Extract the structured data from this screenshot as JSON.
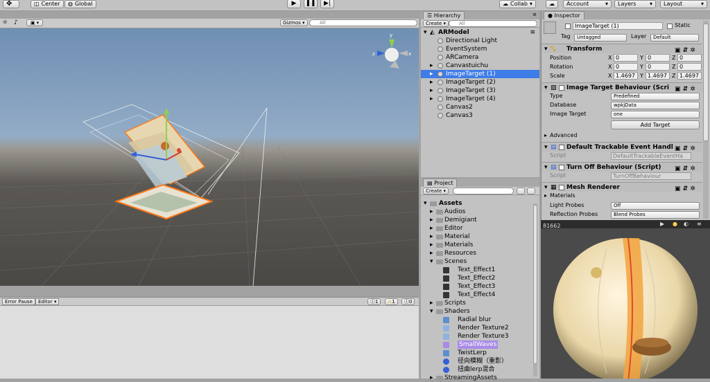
{
  "toolbar": {
    "pivot": "Center",
    "space": "Global",
    "collab": "Collab",
    "account": "Account",
    "layers": "Layers",
    "layout": "Layout"
  },
  "scene": {
    "gizmos": "Gizmos",
    "search_placeholder": "All"
  },
  "console": {
    "error_pause": "Error Pause",
    "editor": "Editor",
    "log_count": "1",
    "warn_count": "1",
    "error_count": "0"
  },
  "hierarchy": {
    "tab": "Hierarchy",
    "create": "Create",
    "search_placeholder": "All",
    "root": "ARModel",
    "items": [
      {
        "label": "Directional Light",
        "expandable": false
      },
      {
        "label": "EventSystem",
        "expandable": false
      },
      {
        "label": "ARCamera",
        "expandable": false
      },
      {
        "label": "Canvastuichu",
        "expandable": true
      },
      {
        "label": "ImageTarget (1)",
        "expandable": true,
        "selected": true
      },
      {
        "label": "ImageTarget (2)",
        "expandable": true
      },
      {
        "label": "ImageTarget (3)",
        "expandable": true
      },
      {
        "label": "ImageTarget (4)",
        "expandable": true
      },
      {
        "label": "Canvas2",
        "expandable": false
      },
      {
        "label": "Canvas3",
        "expandable": false
      }
    ]
  },
  "project": {
    "tab": "Project",
    "create": "Create",
    "root": "Assets",
    "items": [
      {
        "label": "Audios",
        "type": "folder",
        "indent": 1
      },
      {
        "label": "Demigiant",
        "type": "folder",
        "indent": 1
      },
      {
        "label": "Editor",
        "type": "folder",
        "indent": 1
      },
      {
        "label": "Material",
        "type": "folder",
        "indent": 1
      },
      {
        "label": "Materials",
        "type": "folder",
        "indent": 1
      },
      {
        "label": "Resources",
        "type": "folder",
        "indent": 1
      },
      {
        "label": "Scenes",
        "type": "folder-open",
        "indent": 1
      },
      {
        "label": "Text_Effect1",
        "type": "scene",
        "indent": 2
      },
      {
        "label": "Text_Effect2",
        "type": "scene",
        "indent": 2
      },
      {
        "label": "Text_Effect3",
        "type": "scene",
        "indent": 2
      },
      {
        "label": "Text_Effect4",
        "type": "scene",
        "indent": 2
      },
      {
        "label": "Scripts",
        "type": "folder",
        "indent": 1
      },
      {
        "label": "Shaders",
        "type": "folder-open",
        "indent": 1
      },
      {
        "label": "Radial blur",
        "type": "shader",
        "indent": 2
      },
      {
        "label": "Render Texture2",
        "type": "rt",
        "indent": 2
      },
      {
        "label": "Render Texture3",
        "type": "rt",
        "indent": 2
      },
      {
        "label": "SmallWaves",
        "type": "purple",
        "indent": 2
      },
      {
        "label": "TwistLerp",
        "type": "shader",
        "indent": 2
      },
      {
        "label": "径向模糊（重影）",
        "type": "sphere",
        "indent": 2
      },
      {
        "label": "扭曲lerp混合",
        "type": "sphere",
        "indent": 2
      },
      {
        "label": "StreamingAssets",
        "type": "folder",
        "indent": 1
      }
    ]
  },
  "inspector": {
    "tab": "Inspector",
    "object_name": "ImageTarget (1)",
    "static_label": "Static",
    "tag_label": "Tag",
    "tag_value": "Untagged",
    "layer_label": "Layer",
    "layer_value": "Default",
    "transform": {
      "title": "Transform",
      "position_label": "Position",
      "position": [
        "0",
        "0",
        "0"
      ],
      "rotation_label": "Rotation",
      "rotation": [
        "0",
        "0",
        "0"
      ],
      "scale_label": "Scale",
      "scale": [
        "1.4697",
        "1.4697",
        "1.4697"
      ],
      "axes": [
        "X",
        "Y",
        "Z"
      ]
    },
    "image_target": {
      "title": "Image Target Behaviour (Scri",
      "type_label": "Type",
      "type_value": "Predefined",
      "database_label": "Database",
      "database_value": "wpkjData",
      "image_target_label": "Image Target",
      "image_target_value": "one",
      "add_button": "Add Target",
      "advanced": "Advanced"
    },
    "trackable": {
      "title": "Default Trackable Event Handl",
      "script_label": "Script",
      "script_value": "DefaultTrackableEventHa"
    },
    "turnoff": {
      "title": "Turn Off Behaviour (Script)",
      "script_label": "Script",
      "script_value": "TurnOffBehaviour"
    },
    "mesh": {
      "title": "Mesh Renderer",
      "materials": "Materials",
      "light_probes_label": "Light Probes",
      "light_probes_value": "Off",
      "reflection_label": "Reflection Probes",
      "reflection_value": "Blend Probes"
    },
    "preview_text": "81662"
  },
  "colors": {
    "selection": "#3e7ce7",
    "panel": "#c2c2c2",
    "accent_orange": "#ff7a1a"
  }
}
